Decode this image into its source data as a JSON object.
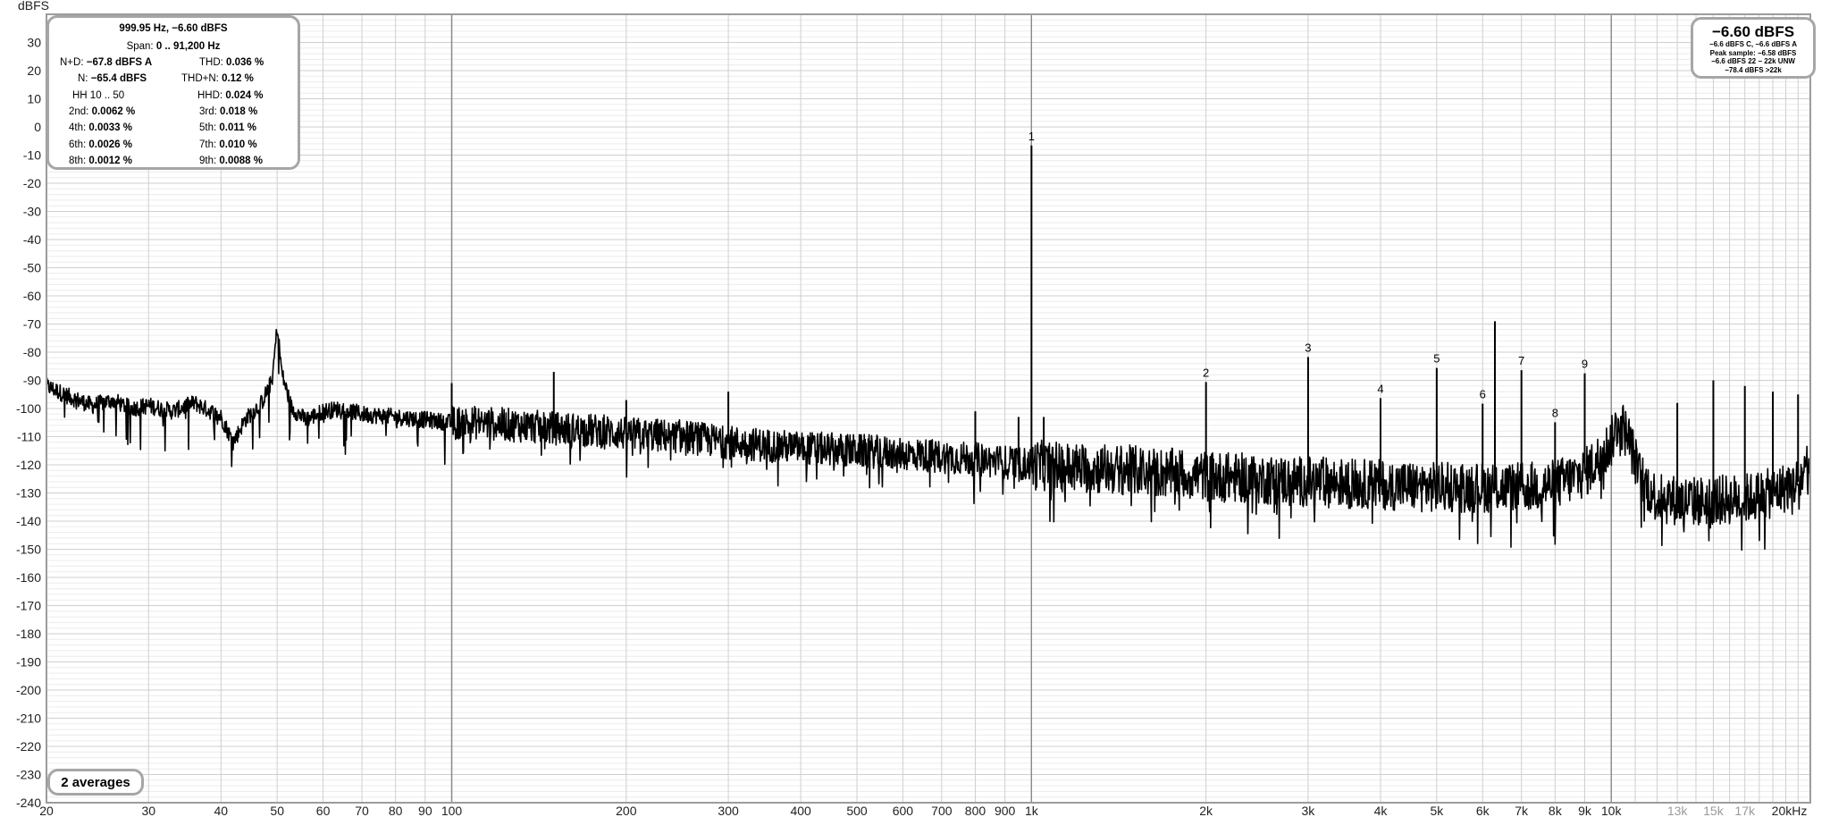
{
  "chart_data": {
    "type": "line",
    "ylabel": "dBFS",
    "xscale": "log",
    "xlim": [
      20,
      22050
    ],
    "ylim": [
      -240,
      40
    ],
    "grid": true,
    "y_ticks": [
      "30",
      "20",
      "10",
      "0",
      "-10",
      "-20",
      "-30",
      "-40",
      "-50",
      "-60",
      "-70",
      "-80",
      "-90",
      "-100",
      "-110",
      "-120",
      "-130",
      "-140",
      "-150",
      "-160",
      "-170",
      "-180",
      "-190",
      "-200",
      "-210",
      "-220",
      "-230",
      "-240"
    ],
    "x_ticks": [
      {
        "f": 20,
        "label": "20"
      },
      {
        "f": 30,
        "label": "30"
      },
      {
        "f": 40,
        "label": "40"
      },
      {
        "f": 50,
        "label": "50"
      },
      {
        "f": 60,
        "label": "60"
      },
      {
        "f": 70,
        "label": "70"
      },
      {
        "f": 80,
        "label": "80"
      },
      {
        "f": 90,
        "label": "90"
      },
      {
        "f": 100,
        "label": "100"
      },
      {
        "f": 200,
        "label": "200"
      },
      {
        "f": 300,
        "label": "300"
      },
      {
        "f": 400,
        "label": "400"
      },
      {
        "f": 500,
        "label": "500"
      },
      {
        "f": 600,
        "label": "600"
      },
      {
        "f": 700,
        "label": "700"
      },
      {
        "f": 800,
        "label": "800"
      },
      {
        "f": 900,
        "label": "900"
      },
      {
        "f": 1000,
        "label": "1k"
      },
      {
        "f": 2000,
        "label": "2k"
      },
      {
        "f": 3000,
        "label": "3k"
      },
      {
        "f": 4000,
        "label": "4k"
      },
      {
        "f": 5000,
        "label": "5k"
      },
      {
        "f": 6000,
        "label": "6k"
      },
      {
        "f": 7000,
        "label": "7k"
      },
      {
        "f": 8000,
        "label": "8k"
      },
      {
        "f": 9000,
        "label": "9k"
      },
      {
        "f": 10000,
        "label": "10k"
      },
      {
        "f": 13000,
        "label": "13k",
        "dim": true
      },
      {
        "f": 15000,
        "label": "15k",
        "dim": true
      },
      {
        "f": 17000,
        "label": "17k",
        "dim": true
      },
      {
        "f": 20000,
        "label": "20kHz"
      }
    ],
    "series": [
      {
        "points": [
          [
            20,
            -92
          ],
          [
            22,
            -96
          ],
          [
            24,
            -99
          ],
          [
            26,
            -97
          ],
          [
            28,
            -100
          ],
          [
            30,
            -99
          ],
          [
            33,
            -101
          ],
          [
            36,
            -98
          ],
          [
            40,
            -103
          ],
          [
            42,
            -112
          ],
          [
            44,
            -104
          ],
          [
            47,
            -98
          ],
          [
            49,
            -90
          ],
          [
            50,
            -71
          ],
          [
            51,
            -88
          ],
          [
            53,
            -100
          ],
          [
            56,
            -104
          ],
          [
            60,
            -101
          ],
          [
            65,
            -100
          ],
          [
            70,
            -102
          ],
          [
            80,
            -103
          ],
          [
            90,
            -104
          ],
          [
            100,
            -105
          ],
          [
            110,
            -105
          ],
          [
            130,
            -106
          ],
          [
            150,
            -107
          ],
          [
            180,
            -108
          ],
          [
            200,
            -109
          ],
          [
            250,
            -110
          ],
          [
            300,
            -112
          ],
          [
            400,
            -114
          ],
          [
            500,
            -115
          ],
          [
            600,
            -116
          ],
          [
            700,
            -117
          ],
          [
            800,
            -118
          ],
          [
            1000,
            -120
          ],
          [
            1200,
            -121
          ],
          [
            1500,
            -122
          ],
          [
            2000,
            -124
          ],
          [
            3000,
            -126
          ],
          [
            4000,
            -127
          ],
          [
            5000,
            -128
          ],
          [
            6000,
            -128
          ],
          [
            7000,
            -128
          ],
          [
            8000,
            -127
          ],
          [
            9000,
            -123
          ],
          [
            9500,
            -118
          ],
          [
            10000,
            -112
          ],
          [
            10300,
            -104
          ],
          [
            10700,
            -110
          ],
          [
            11200,
            -124
          ],
          [
            12000,
            -132
          ],
          [
            14000,
            -133
          ],
          [
            17000,
            -132
          ],
          [
            19000,
            -130
          ],
          [
            21000,
            -126
          ],
          [
            22050,
            -120
          ]
        ]
      }
    ],
    "spikes": [
      {
        "f": 50,
        "db": -71
      },
      {
        "f": 100,
        "db": -91
      },
      {
        "f": 150,
        "db": -87
      },
      {
        "f": 200,
        "db": -97
      },
      {
        "f": 300,
        "db": -94
      },
      {
        "f": 800,
        "db": -101
      },
      {
        "f": 950,
        "db": -103
      },
      {
        "f": 1000,
        "db": -6.6
      },
      {
        "f": 1050,
        "db": -103
      },
      {
        "f": 2000,
        "db": -90.6
      },
      {
        "f": 3000,
        "db": -81.7
      },
      {
        "f": 4000,
        "db": -96.3
      },
      {
        "f": 5000,
        "db": -85.6
      },
      {
        "f": 6000,
        "db": -98.3
      },
      {
        "f": 6300,
        "db": -69
      },
      {
        "f": 7000,
        "db": -86.4
      },
      {
        "f": 8000,
        "db": -104.9
      },
      {
        "f": 9000,
        "db": -87.5
      },
      {
        "f": 13000,
        "db": -98
      },
      {
        "f": 15000,
        "db": -90
      },
      {
        "f": 17000,
        "db": -92
      },
      {
        "f": 19000,
        "db": -94
      },
      {
        "f": 21000,
        "db": -95
      }
    ],
    "harmonic_labels": [
      {
        "f": 1000,
        "db": -6.6,
        "label": "1"
      },
      {
        "f": 2000,
        "db": -90.6,
        "label": "2"
      },
      {
        "f": 3000,
        "db": -81.7,
        "label": "3"
      },
      {
        "f": 4000,
        "db": -96.3,
        "label": "4"
      },
      {
        "f": 5000,
        "db": -85.6,
        "label": "5"
      },
      {
        "f": 6000,
        "db": -98.3,
        "label": "6"
      },
      {
        "f": 7000,
        "db": -86.4,
        "label": "7"
      },
      {
        "f": 8000,
        "db": -104.9,
        "label": "8"
      },
      {
        "f": 9000,
        "db": -87.5,
        "label": "9"
      }
    ]
  },
  "stats": {
    "title": "999.95 Hz, −6.60 dBFS",
    "span_label": "Span:",
    "span_value": "0 .. 91,200 Hz",
    "rows": [
      {
        "l": "N+D:",
        "lv": "−67.8 dBFS A",
        "r": "THD:",
        "rv": "0.036 %"
      },
      {
        "l": "N:",
        "lv": "−65.4 dBFS",
        "r": "THD+N:",
        "rv": "0.12 %"
      },
      {
        "l": "HH 10 .. 50",
        "lv": "",
        "r": "HHD:",
        "rv": "0.024 %"
      },
      {
        "l": "2nd:",
        "lv": "0.0062 %",
        "r": "3rd:",
        "rv": "0.018 %"
      },
      {
        "l": "4th:",
        "lv": "0.0033 %",
        "r": "5th:",
        "rv": "0.011 %"
      },
      {
        "l": "6th:",
        "lv": "0.0026 %",
        "r": "7th:",
        "rv": "0.010 %"
      },
      {
        "l": "8th:",
        "lv": "0.0012 %",
        "r": "9th:",
        "rv": "0.0088 %"
      }
    ]
  },
  "level": {
    "main": "−6.60 dBFS",
    "lines": [
      "−6.6 dBFS C, −6.6 dBFS A",
      "Peak sample: −6.58 dBFS",
      "−6.6 dBFS 22 − 22k UNW",
      "−78.4 dBFS >22k"
    ]
  },
  "averages_label": "2 averages"
}
